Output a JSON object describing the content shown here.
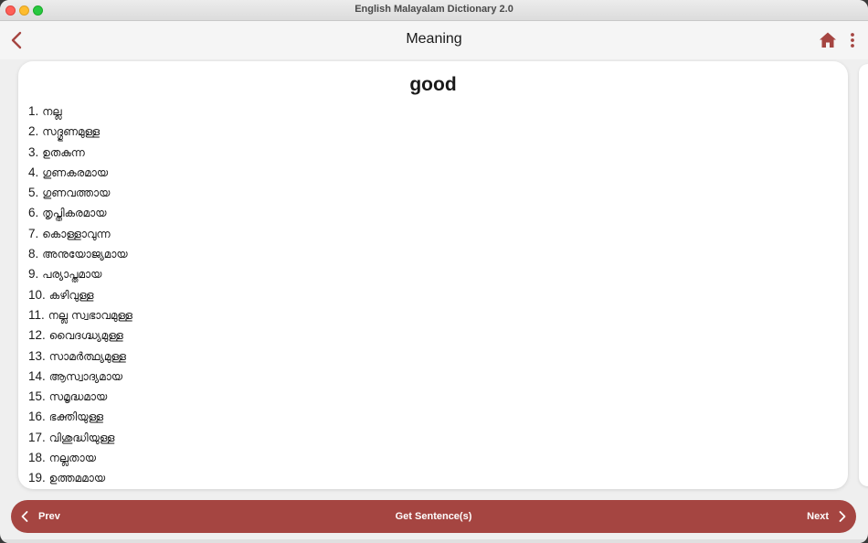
{
  "window": {
    "title": "English Malayalam Dictionary 2.0"
  },
  "appbar": {
    "title": "Meaning",
    "icons": {
      "back": "chevron-left-icon",
      "home": "home-icon",
      "more": "more-vertical-icon"
    },
    "accent": "#a54541"
  },
  "entry": {
    "word": "good",
    "meanings": [
      {
        "num": "1.",
        "text": "നല്ല"
      },
      {
        "num": "2.",
        "text": "സദ്ഗുണമുള്ള"
      },
      {
        "num": "3.",
        "text": "ഉതകുന്ന"
      },
      {
        "num": "4.",
        "text": "ഗുണകരമായ"
      },
      {
        "num": "5.",
        "text": "ഗുണവത്തായ"
      },
      {
        "num": "6.",
        "text": "തൃപ്തികരമായ"
      },
      {
        "num": "7.",
        "text": "കൊള്ളാവുന്ന"
      },
      {
        "num": "8.",
        "text": "അനുയോജ്യമായ"
      },
      {
        "num": "9.",
        "text": "പര്യാപ്തമായ"
      },
      {
        "num": "10.",
        "text": "കഴിവുള്ള"
      },
      {
        "num": "11.",
        "text": "നല്ല സ്വഭാവമുള്ള"
      },
      {
        "num": "12.",
        "text": "വൈദഗ്ദ്ധ്യമുള്ള"
      },
      {
        "num": "13.",
        "text": "സാമർത്ഥ്യമുള്ള"
      },
      {
        "num": "14.",
        "text": "ആസ്വാദ്യമായ"
      },
      {
        "num": "15.",
        "text": "സമൃദ്ധമായ"
      },
      {
        "num": "16.",
        "text": "ഭക്തിയുള്ള"
      },
      {
        "num": "17.",
        "text": "വിശുദ്ധിയുള്ള"
      },
      {
        "num": "18.",
        "text": "നല്ലതായ"
      },
      {
        "num": "19.",
        "text": "ഉത്തമമായ"
      }
    ]
  },
  "bottombar": {
    "prev_label": "Prev",
    "sentence_label": "Get Sentence(s)",
    "next_label": "Next",
    "icons": {
      "prev": "chevron-left-icon",
      "next": "chevron-right-icon"
    },
    "color": "#a54541"
  }
}
